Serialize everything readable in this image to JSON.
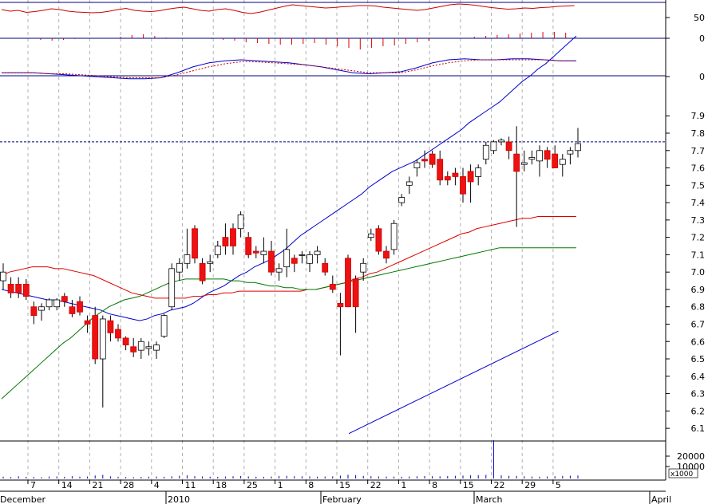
{
  "chart_data": [
    {
      "type": "line",
      "panel": "oscillator",
      "y_ticks": [
        "50",
        "0"
      ],
      "ylim": [
        -10,
        80
      ],
      "reference_line": 80,
      "series": [
        {
          "values": [
            62,
            58,
            60,
            55,
            57,
            60,
            64,
            62,
            58,
            56,
            55,
            54,
            55,
            58,
            62,
            65,
            60,
            58,
            57,
            59,
            63,
            66,
            68,
            64,
            60,
            58,
            62,
            64,
            60,
            55,
            52,
            55,
            60,
            65,
            70,
            74,
            72,
            70,
            68,
            66,
            67,
            69,
            70,
            72,
            72,
            71,
            68,
            66,
            64,
            62,
            60,
            62,
            66,
            70,
            74,
            76,
            75,
            73,
            70,
            67,
            65,
            63,
            64,
            66,
            65,
            67,
            68,
            70,
            71,
            72
          ]
        }
      ],
      "histogram": [
        0,
        0,
        0,
        -2,
        -3,
        -2,
        -1,
        0,
        0,
        0,
        2,
        4,
        5,
        3,
        1,
        0,
        0,
        0,
        -1,
        -2,
        -3,
        -5,
        -6,
        -7,
        -8,
        -8,
        -7,
        -6,
        -8,
        -10,
        -12,
        -14,
        -12,
        -10,
        -9,
        -7,
        -5,
        -3,
        0,
        0,
        0,
        2,
        3,
        4,
        5,
        6,
        7,
        8,
        8,
        7
      ]
    },
    {
      "type": "line",
      "panel": "macd",
      "y_ticks": [
        "0"
      ],
      "ylim": [
        -0.15,
        0.25
      ],
      "series": [
        {
          "values": [
            0.0,
            0.0,
            0.0,
            -0.01,
            -0.02,
            -0.03,
            -0.04,
            -0.05,
            -0.06,
            -0.06,
            -0.05,
            0.0,
            0.06,
            0.1,
            0.12,
            0.13,
            0.12,
            0.11,
            0.1,
            0.08,
            0.06,
            0.03,
            0.0,
            -0.01,
            0.0,
            0.01,
            0.05,
            0.1,
            0.13,
            0.14,
            0.13,
            0.13,
            0.14,
            0.14,
            0.13,
            0.12,
            0.12
          ]
        },
        {
          "values": [
            0.0,
            0.0,
            0.0,
            -0.01,
            -0.01,
            -0.02,
            -0.03,
            -0.04,
            -0.05,
            -0.05,
            -0.05,
            -0.02,
            0.02,
            0.06,
            0.09,
            0.11,
            0.11,
            0.1,
            0.09,
            0.08,
            0.06,
            0.04,
            0.02,
            0.0,
            0.0,
            0.0,
            0.03,
            0.07,
            0.1,
            0.12,
            0.13,
            0.13,
            0.13,
            0.13,
            0.13,
            0.12,
            0.12
          ]
        }
      ]
    },
    {
      "type": "candlestick",
      "panel": "price",
      "y_ticks": [
        "7.9",
        "7.8",
        "7.7",
        "7.6",
        "7.5",
        "7.4",
        "7.3",
        "7.2",
        "7.1",
        "7.0",
        "6.9",
        "6.8",
        "6.7",
        "6.6",
        "6.5",
        "6.4",
        "6.3",
        "6.2",
        "6.1"
      ],
      "ylim": [
        6.05,
        7.97
      ],
      "resistance_level": 7.75,
      "candles": [
        [
          6.95,
          7.05,
          6.9,
          7.0
        ],
        [
          6.93,
          6.97,
          6.85,
          6.88
        ],
        [
          6.93,
          6.97,
          6.85,
          6.88
        ],
        [
          6.93,
          6.96,
          6.84,
          6.86
        ],
        [
          6.8,
          6.83,
          6.7,
          6.75
        ],
        [
          6.78,
          6.82,
          6.72,
          6.8
        ],
        [
          6.8,
          6.85,
          6.78,
          6.84
        ],
        [
          6.8,
          6.85,
          6.78,
          6.84
        ],
        [
          6.86,
          6.88,
          6.8,
          6.83
        ],
        [
          6.8,
          6.84,
          6.74,
          6.76
        ],
        [
          6.83,
          6.86,
          6.75,
          6.77
        ],
        [
          6.72,
          6.75,
          6.65,
          6.7
        ],
        [
          6.75,
          6.8,
          6.47,
          6.5
        ],
        [
          6.5,
          6.75,
          6.22,
          6.73
        ],
        [
          6.72,
          6.75,
          6.6,
          6.65
        ],
        [
          6.67,
          6.7,
          6.6,
          6.62
        ],
        [
          6.62,
          6.63,
          6.55,
          6.58
        ],
        [
          6.57,
          6.62,
          6.51,
          6.54
        ],
        [
          6.55,
          6.62,
          6.5,
          6.6
        ],
        [
          6.56,
          6.6,
          6.52,
          6.57
        ],
        [
          6.55,
          6.6,
          6.5,
          6.58
        ],
        [
          6.63,
          6.76,
          6.62,
          6.75
        ],
        [
          6.8,
          7.05,
          6.78,
          7.02
        ],
        [
          7.0,
          7.08,
          6.95,
          7.05
        ],
        [
          7.05,
          7.25,
          7.02,
          7.1
        ],
        [
          7.25,
          7.27,
          7.05,
          7.08
        ],
        [
          7.05,
          7.08,
          6.93,
          6.95
        ],
        [
          7.05,
          7.1,
          7.0,
          7.06
        ],
        [
          7.1,
          7.18,
          7.08,
          7.15
        ],
        [
          7.2,
          7.28,
          7.1,
          7.15
        ],
        [
          7.25,
          7.28,
          7.1,
          7.15
        ],
        [
          7.25,
          7.35,
          7.2,
          7.33
        ],
        [
          7.2,
          7.23,
          7.08,
          7.1
        ],
        [
          7.12,
          7.15,
          7.08,
          7.11
        ],
        [
          7.1,
          7.2,
          7.05,
          7.12
        ],
        [
          7.12,
          7.18,
          6.98,
          7.0
        ],
        [
          7.0,
          7.05,
          6.95,
          7.02
        ],
        [
          7.03,
          7.25,
          6.97,
          7.13
        ],
        [
          7.08,
          7.1,
          7.0,
          7.05
        ],
        [
          7.1,
          7.12,
          7.05,
          7.1
        ],
        [
          7.05,
          7.12,
          7.0,
          7.1
        ],
        [
          7.1,
          7.15,
          7.05,
          7.12
        ],
        [
          7.05,
          7.08,
          6.98,
          7.0
        ],
        [
          6.93,
          6.98,
          6.88,
          6.9
        ],
        [
          6.82,
          6.88,
          6.52,
          6.8
        ],
        [
          7.08,
          7.1,
          6.8,
          6.8
        ],
        [
          6.96,
          6.98,
          6.65,
          6.8
        ],
        [
          7.0,
          7.08,
          6.95,
          7.05
        ],
        [
          7.2,
          7.25,
          7.18,
          7.22
        ],
        [
          7.25,
          7.27,
          7.1,
          7.12
        ],
        [
          7.12,
          7.15,
          7.05,
          7.08
        ],
        [
          7.13,
          7.3,
          7.1,
          7.28
        ],
        [
          7.4,
          7.45,
          7.38,
          7.43
        ],
        [
          7.5,
          7.55,
          7.45,
          7.52
        ],
        [
          7.6,
          7.65,
          7.55,
          7.63
        ],
        [
          7.65,
          7.7,
          7.6,
          7.64
        ],
        [
          7.68,
          7.7,
          7.6,
          7.62
        ],
        [
          7.65,
          7.7,
          7.5,
          7.53
        ],
        [
          7.55,
          7.58,
          7.5,
          7.53
        ],
        [
          7.57,
          7.6,
          7.5,
          7.55
        ],
        [
          7.55,
          7.6,
          7.4,
          7.45
        ],
        [
          7.58,
          7.62,
          7.4,
          7.52
        ],
        [
          7.55,
          7.62,
          7.5,
          7.6
        ],
        [
          7.65,
          7.75,
          7.62,
          7.73
        ],
        [
          7.7,
          7.76,
          7.68,
          7.75
        ],
        [
          7.75,
          7.77,
          7.73,
          7.76
        ],
        [
          7.75,
          7.78,
          7.65,
          7.7
        ],
        [
          7.68,
          7.84,
          7.26,
          7.58
        ],
        [
          7.62,
          7.7,
          7.58,
          7.63
        ],
        [
          7.65,
          7.7,
          7.62,
          7.66
        ],
        [
          7.64,
          7.73,
          7.55,
          7.7
        ],
        [
          7.7,
          7.72,
          7.6,
          7.65
        ],
        [
          7.68,
          7.73,
          7.6,
          7.6
        ],
        [
          7.62,
          7.68,
          7.55,
          7.65
        ],
        [
          7.68,
          7.72,
          7.62,
          7.7
        ],
        [
          7.7,
          7.83,
          7.66,
          7.74
        ]
      ],
      "moving_averages": [
        {
          "color": "#0000cc",
          "values": [
            6.9,
            6.89,
            6.88,
            6.87,
            6.86,
            6.85,
            6.84,
            6.84,
            6.83,
            6.82,
            6.81,
            6.8,
            6.79,
            6.78,
            6.76,
            6.75,
            6.74,
            6.73,
            6.72,
            6.73,
            6.75,
            6.76,
            6.78,
            6.79,
            6.8,
            6.82,
            6.85,
            6.88,
            6.9,
            6.92,
            6.95,
            6.98,
            7.0,
            7.03,
            7.05,
            7.07,
            7.1,
            7.13,
            7.17,
            7.21,
            7.24,
            7.27,
            7.3,
            7.33,
            7.36,
            7.39,
            7.42,
            7.45,
            7.49,
            7.52,
            7.55,
            7.58,
            7.6,
            7.62,
            7.64,
            7.67,
            7.7,
            7.73,
            7.76,
            7.79,
            7.82,
            7.86,
            7.89,
            7.92,
            7.95,
            7.98,
            8.02,
            8.06,
            8.1,
            8.13,
            8.17,
            8.2,
            8.24,
            8.28,
            8.32,
            8.36
          ]
        },
        {
          "color": "#dd0000",
          "values": [
            6.98,
            7.0,
            7.01,
            7.02,
            7.03,
            7.03,
            7.03,
            7.02,
            7.02,
            7.01,
            7.0,
            6.99,
            6.98,
            6.96,
            6.94,
            6.92,
            6.9,
            6.88,
            6.87,
            6.86,
            6.85,
            6.85,
            6.85,
            6.85,
            6.85,
            6.86,
            6.86,
            6.87,
            6.87,
            6.88,
            6.88,
            6.89,
            6.89,
            6.89,
            6.89,
            6.89,
            6.89,
            6.89,
            6.89,
            6.89,
            6.9,
            6.9,
            6.91,
            6.92,
            6.93,
            6.94,
            6.96,
            6.97,
            6.99,
            7.0,
            7.02,
            7.04,
            7.06,
            7.08,
            7.1,
            7.12,
            7.14,
            7.16,
            7.18,
            7.2,
            7.22,
            7.23,
            7.25,
            7.26,
            7.27,
            7.28,
            7.29,
            7.3,
            7.31,
            7.31,
            7.32,
            7.32,
            7.32,
            7.32,
            7.32,
            7.32
          ]
        },
        {
          "color": "#007700",
          "values": [
            6.27,
            6.31,
            6.35,
            6.39,
            6.43,
            6.47,
            6.51,
            6.55,
            6.59,
            6.62,
            6.66,
            6.7,
            6.74,
            6.77,
            6.8,
            6.82,
            6.84,
            6.85,
            6.86,
            6.88,
            6.9,
            6.92,
            6.94,
            6.95,
            6.96,
            6.96,
            6.96,
            6.96,
            6.96,
            6.96,
            6.95,
            6.95,
            6.94,
            6.94,
            6.93,
            6.92,
            6.92,
            6.91,
            6.91,
            6.9,
            6.9,
            6.9,
            6.91,
            6.92,
            6.93,
            6.94,
            6.95,
            6.96,
            6.97,
            6.98,
            6.99,
            7.0,
            7.01,
            7.02,
            7.03,
            7.04,
            7.05,
            7.06,
            7.07,
            7.08,
            7.09,
            7.1,
            7.11,
            7.12,
            7.13,
            7.14,
            7.14,
            7.14,
            7.14,
            7.14,
            7.14,
            7.14,
            7.14,
            7.14,
            7.14,
            7.14
          ]
        }
      ],
      "trendline": {
        "from": [
          58,
          6.07
        ],
        "to": [
          93,
          6.66
        ]
      }
    },
    {
      "type": "bar",
      "panel": "volume",
      "y_ticks": [
        "20000",
        "10000"
      ],
      "unit_label": "x1000",
      "ylim": [
        0,
        30000
      ],
      "values": [
        1500,
        1200,
        1800,
        1400,
        1300,
        1100,
        1600,
        1700,
        1400,
        1900,
        1500,
        1600,
        2500,
        3000,
        1800,
        1400,
        1200,
        1100,
        1300,
        1500,
        1600,
        1400,
        1800,
        2200,
        2600,
        1900,
        1700,
        1500,
        1400,
        1600,
        1800,
        2000,
        1700,
        1500,
        1400,
        1600,
        2000,
        2200,
        1900,
        1800,
        1700,
        1500,
        1600,
        1800,
        2400,
        3200,
        2800,
        2100,
        1900,
        1700,
        1600,
        1500,
        1400,
        1600,
        1800,
        2000,
        1900,
        1800,
        2000,
        2200,
        2400,
        2600,
        2800,
        3000,
        32000,
        2600,
        2200,
        2000,
        1800,
        1600,
        1500,
        1700,
        1900,
        2100,
        2300,
        2500
      ]
    }
  ],
  "x_axis": {
    "day_ticks": [
      "7",
      "14",
      "21",
      "28",
      "4",
      "11",
      "18",
      "25",
      "1",
      "8",
      "15",
      "22",
      "1",
      "8",
      "15",
      "22",
      "29",
      "5"
    ],
    "month_labels": [
      "December",
      "2010",
      "February",
      "March",
      "April"
    ]
  }
}
